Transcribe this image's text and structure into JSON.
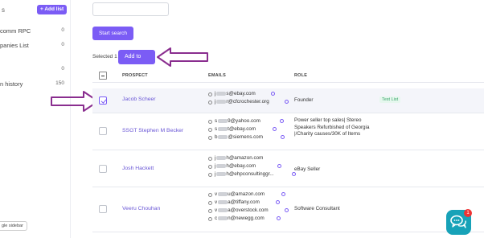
{
  "sidebar": {
    "title": "s",
    "add_list_label": "+ Add list",
    "items": [
      {
        "label": "comm RPC",
        "count": "0"
      },
      {
        "label": "panies List",
        "count": "0"
      },
      {
        "label": "",
        "count": "0"
      },
      {
        "label": "n history",
        "count": "150"
      }
    ],
    "toggle_label": "gle sidebar"
  },
  "search": {
    "placeholder": ""
  },
  "start_search_label": "Start search",
  "selection": {
    "text": "Selected 1",
    "add_to_label": "Add to"
  },
  "table": {
    "headers": {
      "prospect": "PROSPECT",
      "emails": "EMAILS",
      "role": "ROLE"
    },
    "rows": [
      {
        "name": "Jacob Scheer",
        "checked": true,
        "emails": [
          {
            "pre": "j",
            "post": "s@ebay.com"
          },
          {
            "pre": "j",
            "post": "r@cfcrochester.org"
          }
        ],
        "role": "Founder",
        "tag": "Test List"
      },
      {
        "name": "SSGT Stephen M Becker",
        "checked": false,
        "emails": [
          {
            "pre": "s",
            "post": "9@yahoo.com"
          },
          {
            "pre": "s",
            "post": "t@ebay.com"
          },
          {
            "pre": "b",
            "post": "@siemens.com"
          }
        ],
        "role": "Power seller top sales| Stereo Speakers Refurbished of Georgia |/Charity causes/30K of Items",
        "tag": ""
      },
      {
        "name": "Josh Hackett",
        "checked": false,
        "emails": [
          {
            "pre": "j",
            "post": "h@amazon.com"
          },
          {
            "pre": "j",
            "post": "h@ebay.com"
          },
          {
            "pre": "j",
            "post": "h@ehpconsultinggr..."
          }
        ],
        "role": "eBay Seller",
        "tag": ""
      },
      {
        "name": "Veeru Chouhan",
        "checked": false,
        "emails": [
          {
            "pre": "v",
            "post": "u@amazon.com"
          },
          {
            "pre": "v",
            "post": "a@tiffany.com"
          },
          {
            "pre": "v",
            "post": "a@overstock.com"
          },
          {
            "pre": "c",
            "post": "n@newegg.com"
          }
        ],
        "role": "Software Consultant",
        "tag": ""
      }
    ]
  },
  "chat": {
    "badge": "1",
    "icon": "chat-bubbles-icon"
  },
  "colors": {
    "accent": "#7b5cf5",
    "annotation_arrow": "#8a2e8f",
    "chat": "#17a2b8",
    "tag": "#3aa66b"
  }
}
